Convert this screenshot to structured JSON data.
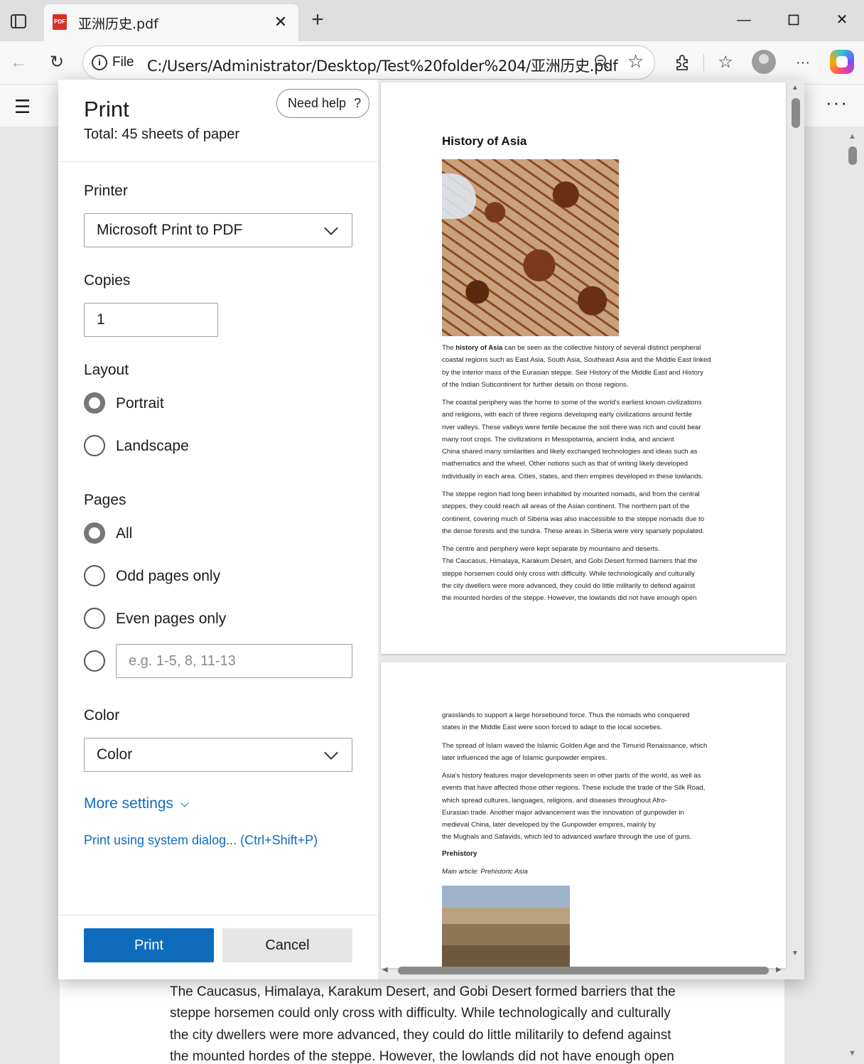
{
  "browser": {
    "tab_title": "亚洲历史.pdf",
    "tab_icon_text": "PDF",
    "new_tab_symbol": "+",
    "scheme_label": "File",
    "url": "C:/Users/Administrator/Desktop/Test%20folder%204/亚洲历史.pdf"
  },
  "print_dialog": {
    "title": "Print",
    "total": "Total: 45 sheets of paper",
    "help_label": "Need help",
    "printer": {
      "label": "Printer",
      "value": "Microsoft Print to PDF"
    },
    "copies": {
      "label": "Copies",
      "value": "1"
    },
    "layout": {
      "label": "Layout",
      "options": [
        "Portrait",
        "Landscape"
      ],
      "selected": "Portrait"
    },
    "pages": {
      "label": "Pages",
      "options": [
        "All",
        "Odd pages only",
        "Even pages only"
      ],
      "selected": "All",
      "range_placeholder": "e.g. 1-5, 8, 11-13"
    },
    "color": {
      "label": "Color",
      "value": "Color"
    },
    "more_settings": "More settings",
    "system_dialog": "Print using system dialog... (Ctrl+Shift+P)",
    "print_button": "Print",
    "cancel_button": "Cancel"
  },
  "preview": {
    "page1": {
      "title": "History of Asia",
      "p1": [
        "The ",
        "history of Asia",
        " can be seen as the collective history of several distinct peripheral",
        "coastal regions such as East Asia, South Asia, Southeast Asia and the Middle East linked",
        "by the interior mass of the Eurasian steppe. See History of the Middle East and History",
        "of the Indian Subcontinent for further details on those regions."
      ],
      "p2": [
        "The coastal periphery was the home to some of the world's earliest known civilizations",
        "and religions, with each of three regions developing early civilizations around fertile",
        "river valleys. These valleys were fertile because the soil there was rich and could bear",
        "many root crops. The civilizations in Mesopotamia, ancient India, and ancient",
        "China shared many similarities and likely exchanged technologies and ideas such as",
        "mathematics and the wheel. Other notions such as that of writing likely developed",
        "individually in each area. Cities, states, and then empires developed in these lowlands."
      ],
      "p3": [
        "The steppe region had long been inhabited by mounted nomads, and from the central",
        "steppes, they could reach all areas of the Asian continent. The northern part of the",
        "continent, covering much of Siberia was also inaccessible to the steppe nomads due to",
        "the dense forests and the tundra. These areas in Siberia were very sparsely populated."
      ],
      "p4": [
        "The centre and periphery were kept separate by mountains and deserts.",
        "The Caucasus, Himalaya, Karakum Desert, and Gobi Desert formed barriers that the",
        "steppe horsemen could only cross with difficulty. While technologically and culturally",
        "the city dwellers were more advanced, they could do little militarily to defend against",
        "the mounted hordes of the steppe. However, the lowlands did not have enough open"
      ]
    },
    "page2": {
      "p1": [
        "grasslands to support a large horsebound force. Thus the nomads who conquered",
        "states in the Middle East were soon forced to adapt to the local societies."
      ],
      "p2": [
        "The spread of Islam waved the Islamic Golden Age and the Timurid Renaissance, which",
        "later influenced the age of Islamic gunpowder empires."
      ],
      "p3": [
        "Asia's history features major developments seen in other parts of the world, as well as",
        "events that have affected those other regions. These include the trade of the Silk Road,",
        "which spread cultures, languages, religions, and diseases throughout Afro-",
        "Eurasian trade. Another major advancement was the innovation of gunpowder in",
        "medieval China, later developed by the Gunpowder empires, mainly by",
        "the Mughals and Safavids, which led to advanced warfare through the use of guns."
      ],
      "subhead": "Prehistory",
      "caption": "Main article: Prehistoric Asia"
    }
  },
  "background_page": {
    "lines": [
      "The Caucasus, Himalaya, Karakum Desert, and Gobi Desert formed barriers that the",
      "steppe horsemen could only cross with difficulty. While technologically and culturally",
      "the city dwellers were more advanced, they could do little militarily to defend against",
      "the mounted hordes of the steppe. However, the lowlands did not have enough open"
    ]
  }
}
